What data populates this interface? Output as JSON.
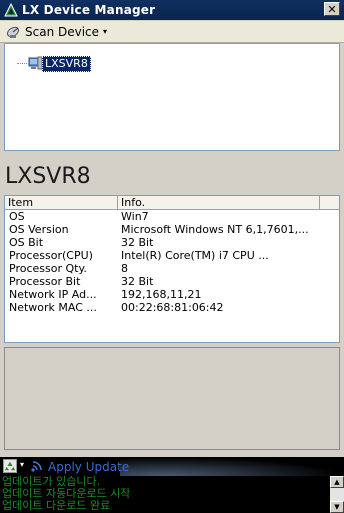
{
  "window": {
    "title": "LX Device Manager",
    "close_glyph": "✕"
  },
  "toolbar": {
    "scan_label": "Scan Device",
    "scan_icon": "satellite-dish-icon",
    "chevron": "▾"
  },
  "tree": {
    "node_label": "LXSVR8",
    "node_icon": "server-icon"
  },
  "device": {
    "name": "LXSVR8"
  },
  "info_table": {
    "headers": [
      "Item",
      "Info."
    ],
    "rows": [
      [
        "OS",
        "Win7"
      ],
      [
        "OS Version",
        "Microsoft Windows NT 6,1,7601,..."
      ],
      [
        "OS Bit",
        "32 Bit"
      ],
      [
        "Processor(CPU)",
        "Intel(R) Core(TM) i7 CPU       ..."
      ],
      [
        "Processor Qty.",
        "8"
      ],
      [
        "Processor Bit",
        "32 Bit"
      ],
      [
        "Network IP Ad...",
        "192,168,11,21"
      ],
      [
        "Network MAC ...",
        "00:22:68:81:06:42"
      ]
    ]
  },
  "update": {
    "label": "Apply Update",
    "chevron": "▾"
  },
  "log": {
    "lines": [
      "업데이트가 있습니다.",
      "업데이트 자동다운로드 시작",
      "업데이트 다운로드 완료"
    ],
    "scroll_up": "▲",
    "scroll_down": "▼"
  },
  "colors": {
    "titlebar": "#0a2450",
    "selection": "#0a246a",
    "log_text": "#1a8c2a",
    "update_label": "#3a6ad8"
  }
}
